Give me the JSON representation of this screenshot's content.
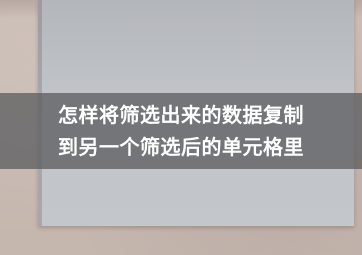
{
  "caption": {
    "line1": "怎样将筛选出来的数据复制",
    "line2": "到另一个筛选后的单元格里"
  },
  "colors": {
    "background": "#c9bbb3",
    "card": "#c0c3c7",
    "banner": "#5f5f62",
    "text": "#ffffff"
  }
}
